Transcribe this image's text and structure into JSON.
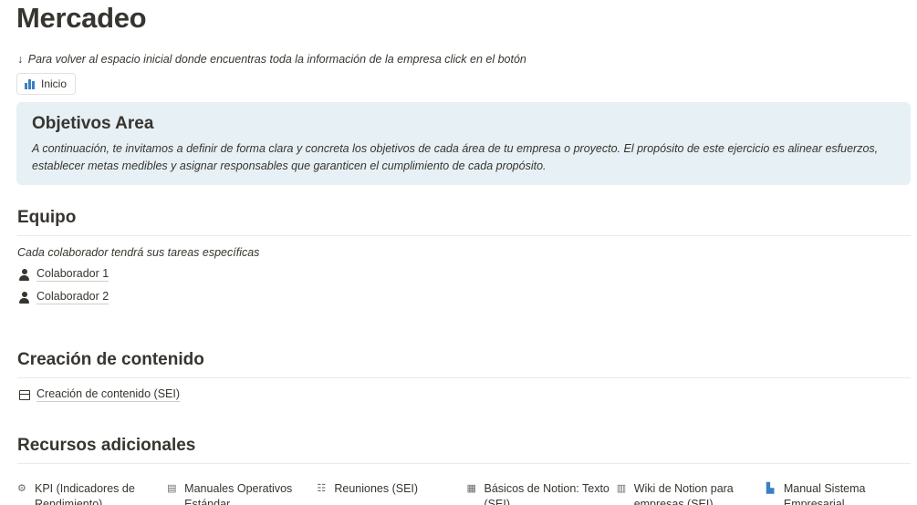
{
  "page": {
    "title": "Mercadeo",
    "hint_arrow": "↓",
    "hint": "Para volver al espacio inicial donde encuentras toda la información de la empresa click en el botón",
    "home_button": "Inicio"
  },
  "callout": {
    "title": "Objetivos Area",
    "body": "A continuación, te invitamos a definir de forma clara y concreta los objetivos de cada área de tu empresa o proyecto. El propósito de este ejercicio es alinear esfuerzos, establecer metas medibles y asignar responsables que garanticen el cumplimiento de cada propósito."
  },
  "equipo": {
    "heading": "Equipo",
    "caption": "Cada colaborador tendrá sus tareas específicas",
    "members": [
      "Colaborador 1",
      "Colaborador 2"
    ]
  },
  "contenido": {
    "heading": "Creación de contenido",
    "link": "Creación de contenido (SEI)"
  },
  "recursos": {
    "heading": "Recursos adicionales",
    "items": [
      {
        "icon": "gear-chart-icon",
        "label": "KPI (Indicadores de Rendimiento)"
      },
      {
        "icon": "book-icon",
        "label": "Manuales Operativos Estándar"
      },
      {
        "icon": "meeting-icon",
        "label": "Reuniones (SEI)"
      },
      {
        "icon": "text-doc-icon",
        "label": "Básicos de Notion: Texto (SEI)"
      },
      {
        "icon": "wiki-icon",
        "label": "Wiki de Notion para empresas (SEI)"
      },
      {
        "icon": "manual-icon",
        "label": "Manual Sistema Empresarial"
      }
    ]
  },
  "colors": {
    "text": "#37352f",
    "callout_bg": "#e7f0f5",
    "accent": "#3b7fc4"
  }
}
